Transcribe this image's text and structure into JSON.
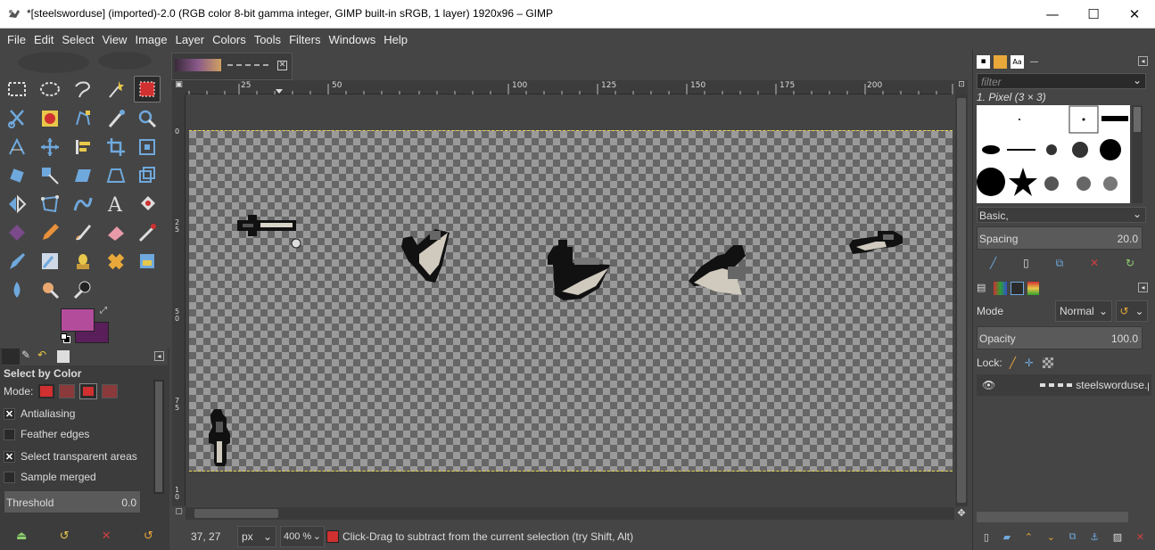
{
  "window": {
    "title": "*[steelsworduse] (imported)-2.0 (RGB color 8-bit gamma integer, GIMP built-in sRGB, 1 layer) 1920x96 – GIMP",
    "minimize": "—",
    "maximize": "☐",
    "close": "✕"
  },
  "menu": [
    "File",
    "Edit",
    "Select",
    "View",
    "Image",
    "Layer",
    "Colors",
    "Tools",
    "Filters",
    "Windows",
    "Help"
  ],
  "colors": {
    "foreground": "#b44c9c",
    "background": "#5a1f5a",
    "accent_guide": "#e6d34a"
  },
  "tool_options": {
    "title": "Select by Color",
    "mode_label": "Mode:",
    "antialiasing": "Antialiasing",
    "antialiasing_checked": true,
    "feather": "Feather edges",
    "feather_checked": false,
    "transparent": "Select transparent areas",
    "transparent_checked": true,
    "sample_merged": "Sample merged",
    "sample_merged_checked": false,
    "threshold_label": "Threshold",
    "threshold_value": "0.0"
  },
  "ruler": {
    "marks": [
      "25",
      "50",
      "100",
      "125",
      "150",
      "175",
      "200"
    ],
    "left_marks": [
      "0",
      "2\n5",
      "5\n0",
      "7\n5",
      "1\n0"
    ]
  },
  "status": {
    "coords": "37, 27",
    "unit": "px",
    "zoom": "400 %",
    "message": "Click-Drag to subtract from the current selection (try Shift, Alt)"
  },
  "brushes": {
    "filter_placeholder": "filter",
    "current_brush": "1. Pixel (3 × 3)",
    "tag": "Basic,",
    "spacing_label": "Spacing",
    "spacing_value": "20.0"
  },
  "layers": {
    "mode_label": "Mode",
    "mode_value": "Normal",
    "opacity_label": "Opacity",
    "opacity_value": "100.0",
    "lock_label": "Lock:",
    "layer_name": "steelsworduse.pn"
  }
}
